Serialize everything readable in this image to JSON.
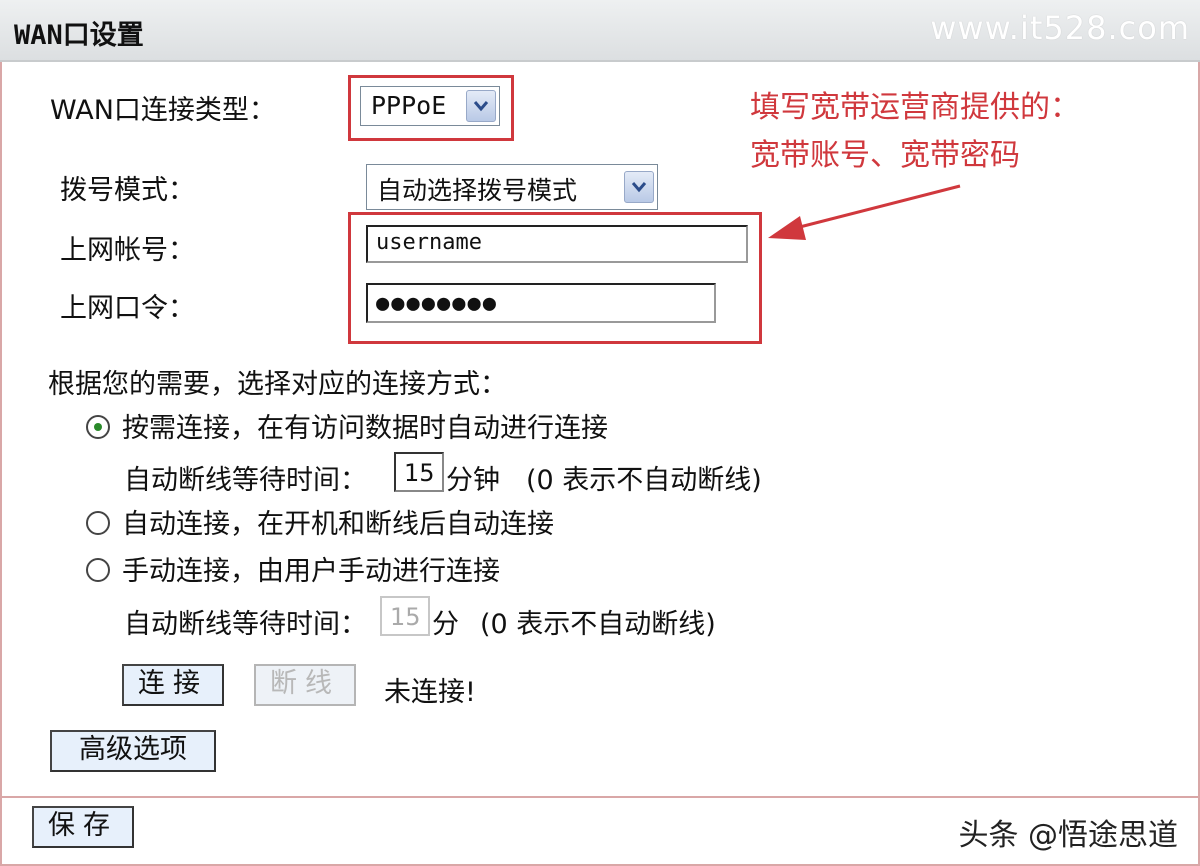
{
  "header": {
    "title": "WAN口设置",
    "watermark": "www.it528.com"
  },
  "wan_type": {
    "label": "WAN口连接类型：",
    "value": "PPPoE"
  },
  "dial_mode": {
    "label": "拨号模式：",
    "value": "自动选择拨号模式"
  },
  "account": {
    "label": "上网帐号：",
    "value": "username"
  },
  "password": {
    "label": "上网口令：",
    "value": "●●●●●●●●"
  },
  "annotation": {
    "line1": "填写宽带运营商提供的：",
    "line2": "宽带账号、宽带密码"
  },
  "connect_section": {
    "label": "根据您的需要，选择对应的连接方式："
  },
  "options": [
    {
      "label": "按需连接，在有访问数据时自动进行连接",
      "selected": true
    },
    {
      "label": "自动连接，在开机和断线后自动连接",
      "selected": false
    },
    {
      "label": "手动连接，由用户手动进行连接",
      "selected": false
    }
  ],
  "idle_on_demand": {
    "label": "自动断线等待时间：",
    "value": "15",
    "unit": "分钟",
    "hint": "(0 表示不自动断线)"
  },
  "idle_manual": {
    "label": "自动断线等待时间：",
    "value": "15",
    "unit": "分",
    "hint": "(0 表示不自动断线)"
  },
  "buttons": {
    "connect": "连接",
    "disconnect": "断线",
    "advanced": "高级选项",
    "save": "保存"
  },
  "status": "未连接!",
  "watermark_bottom": "头条 @悟途思道",
  "colors": {
    "annotation_red": "#d0383d",
    "button_bg": "#e7f0fb"
  }
}
